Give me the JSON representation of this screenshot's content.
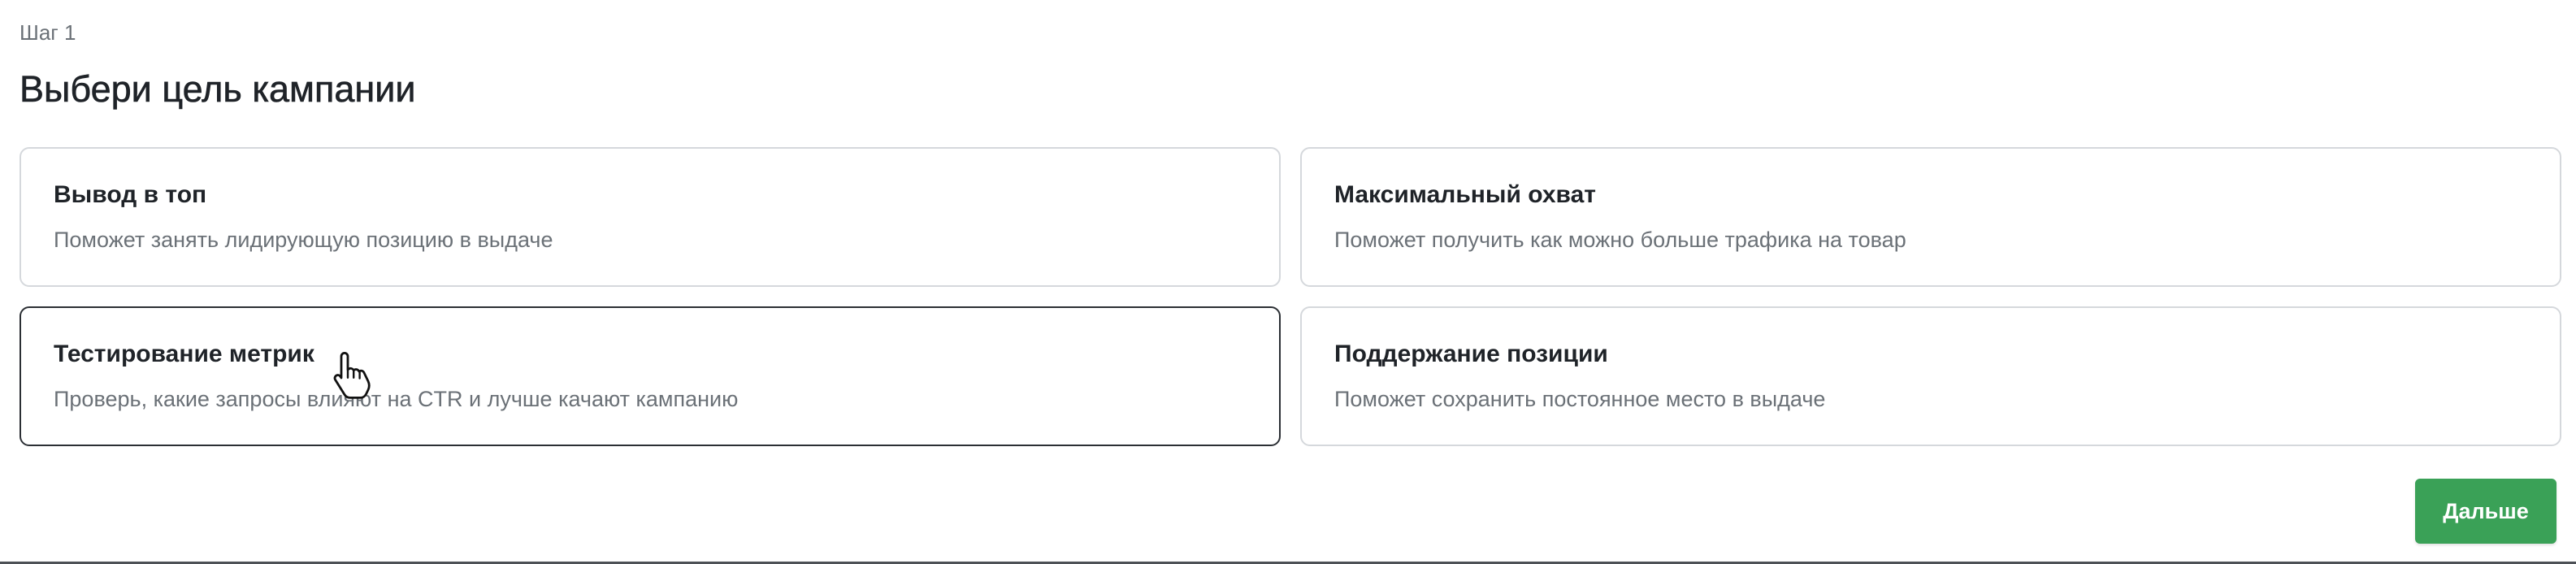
{
  "header": {
    "step": "Шаг 1",
    "title": "Выбери цель кампании"
  },
  "goals": [
    {
      "title": "Вывод в топ",
      "description": "Поможет занять лидирующую позицию в выдаче",
      "selected": false
    },
    {
      "title": "Максимальный охват",
      "description": "Поможет получить как можно больше трафика на товар",
      "selected": false
    },
    {
      "title": "Тестирование метрик",
      "description": "Проверь, какие запросы влияют на CTR и лучше качают кампанию",
      "selected": true
    },
    {
      "title": "Поддержание позиции",
      "description": "Поможет сохранить постоянное место в выдаче",
      "selected": false
    }
  ],
  "actions": {
    "next_label": "Дальше"
  },
  "colors": {
    "primary_button": "#3aa157",
    "selected_border": "#2b2f34",
    "card_border": "#d5d8dc",
    "muted_text": "#6b7177"
  },
  "icons": {
    "cursor": "hand-pointer-icon"
  }
}
